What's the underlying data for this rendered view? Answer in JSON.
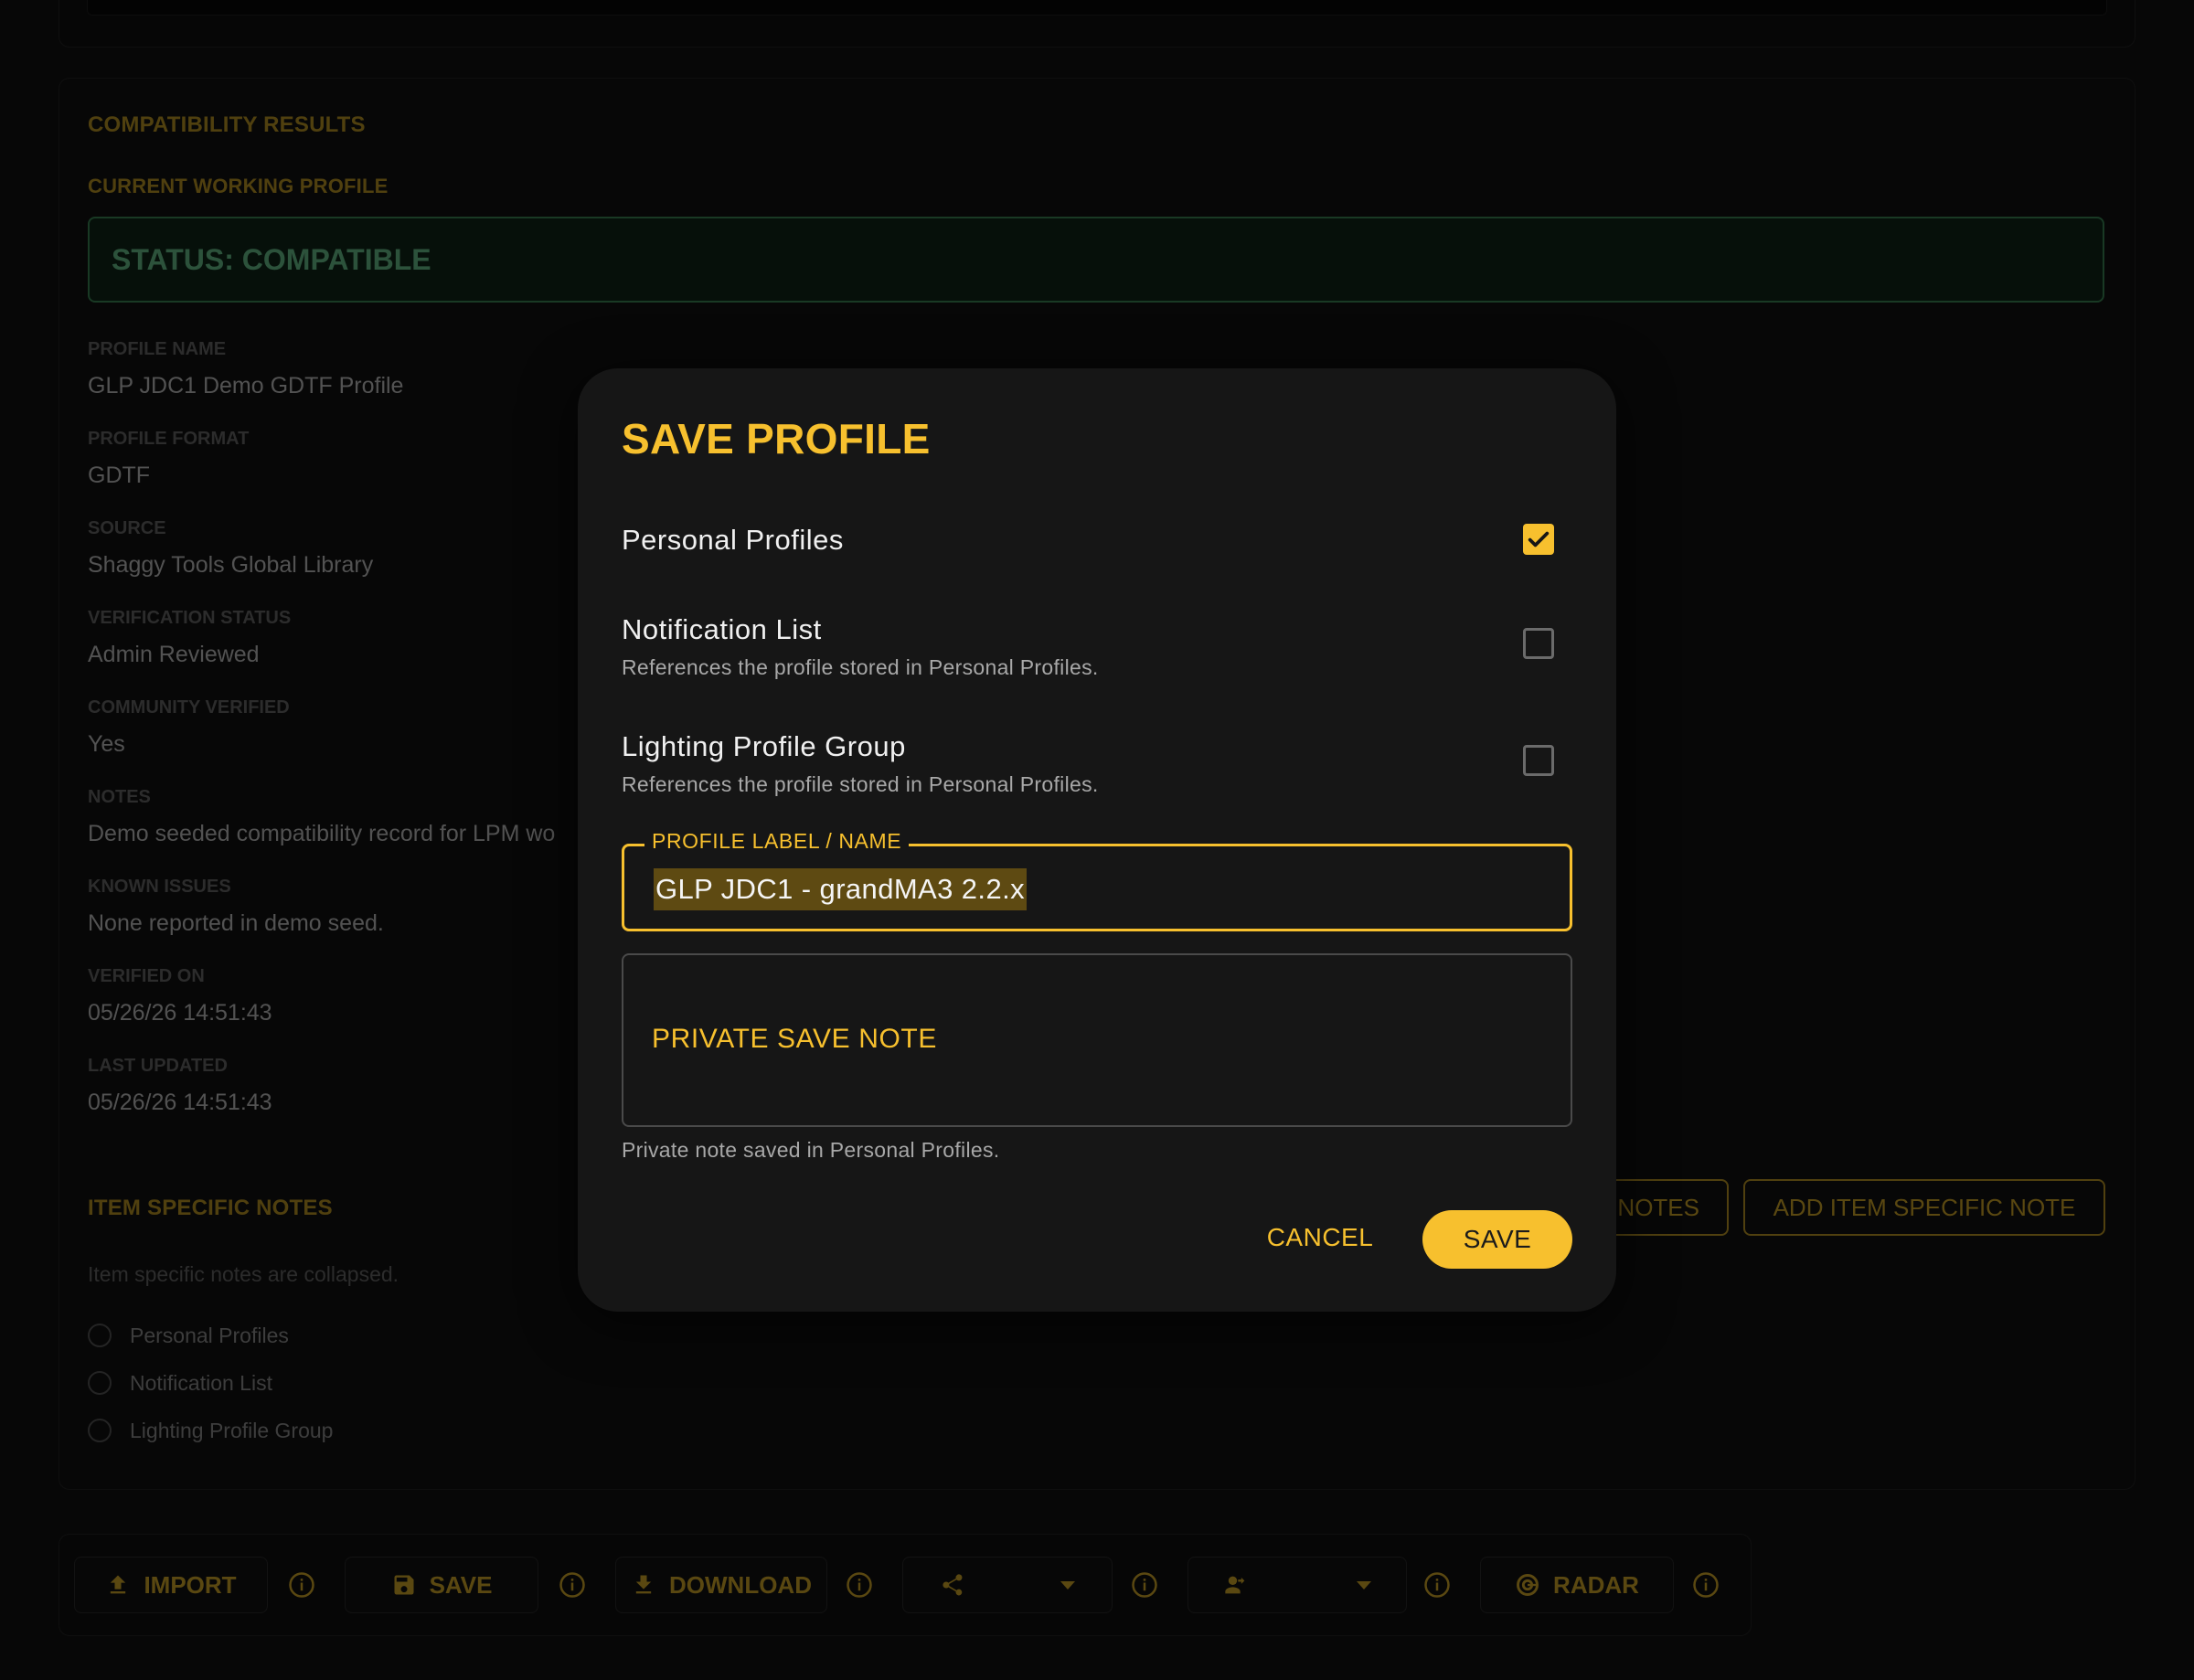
{
  "background": {
    "results_section": {
      "title": "COMPATIBILITY RESULTS",
      "subtitle": "CURRENT WORKING PROFILE",
      "status": "STATUS: COMPATIBLE",
      "fields": [
        {
          "label": "PROFILE NAME",
          "value": "GLP JDC1 Demo GDTF Profile"
        },
        {
          "label": "PROFILE FORMAT",
          "value": "GDTF"
        },
        {
          "label": "SOURCE",
          "value": "Shaggy Tools Global Library"
        },
        {
          "label": "VERIFICATION STATUS",
          "value": "Admin Reviewed"
        },
        {
          "label": "COMMUNITY VERIFIED",
          "value": "Yes"
        },
        {
          "label": "NOTES",
          "value": "Demo seeded compatibility record for LPM wo"
        },
        {
          "label": "KNOWN ISSUES",
          "value": "None reported in demo seed."
        },
        {
          "label": "VERIFIED ON",
          "value": "05/26/26 14:51:43"
        },
        {
          "label": "LAST UPDATED",
          "value": "05/26/26 14:51:43"
        }
      ]
    },
    "item_notes": {
      "title": "ITEM SPECIFIC NOTES",
      "collapsed_text": "Item specific notes are collapsed.",
      "options": [
        "Personal Profiles",
        "Notification List",
        "Lighting Profile Group"
      ],
      "notes_button": "NOTES",
      "add_button": "ADD ITEM SPECIFIC NOTE"
    },
    "toolbar": {
      "import": "IMPORT",
      "save": "SAVE",
      "download": "DOWNLOAD",
      "radar": "RADAR",
      "icons": [
        "upload-icon",
        "save-icon",
        "download-icon",
        "share-icon",
        "person-share-icon",
        "radar-icon",
        "info-icon"
      ]
    }
  },
  "dialog": {
    "title": "SAVE PROFILE",
    "options": [
      {
        "title": "Personal Profiles",
        "subtitle": "",
        "checked": true
      },
      {
        "title": "Notification List",
        "subtitle": "References the profile stored in Personal Profiles.",
        "checked": false
      },
      {
        "title": "Lighting Profile Group",
        "subtitle": "References the profile stored in Personal Profiles.",
        "checked": false
      }
    ],
    "label_field": {
      "legend": "PROFILE LABEL / NAME",
      "value": "GLP JDC1 - grandMA3 2.2.x"
    },
    "note_field": {
      "placeholder": "PRIVATE SAVE NOTE",
      "helper": "Private note saved in Personal Profiles."
    },
    "cancel_label": "CANCEL",
    "save_label": "SAVE"
  },
  "colors": {
    "accent": "#f7c02e",
    "status_green": "#6fcf97",
    "dialog_bg": "#161616",
    "page_bg": "#0b0b0b"
  }
}
